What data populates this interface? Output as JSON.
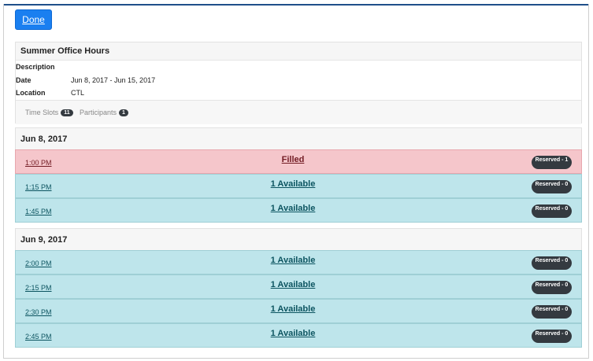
{
  "toolbar": {
    "done_label": "Done"
  },
  "event": {
    "title": "Summer Office Hours",
    "description_label": "Description",
    "date_label": "Date",
    "date_value": "Jun 8, 2017 - Jun 15, 2017",
    "location_label": "Location",
    "location_value": "CTL"
  },
  "tabs": [
    {
      "label": "Time Slots",
      "count": "11"
    },
    {
      "label": "Participants",
      "count": "1"
    }
  ],
  "days": [
    {
      "title": "Jun 8, 2017",
      "slots": [
        {
          "time": "1:00 PM",
          "status": "Filled",
          "reserved": "Reserved - 1",
          "state": "filled"
        },
        {
          "time": "1:15 PM",
          "status": "1 Available",
          "reserved": "Reserved - 0",
          "state": "available"
        },
        {
          "time": "1:45 PM",
          "status": "1 Available",
          "reserved": "Reserved - 0",
          "state": "available"
        }
      ]
    },
    {
      "title": "Jun 9, 2017",
      "slots": [
        {
          "time": "2:00 PM",
          "status": "1 Available",
          "reserved": "Reserved - 0",
          "state": "available"
        },
        {
          "time": "2:15 PM",
          "status": "1 Available",
          "reserved": "Reserved - 0",
          "state": "available"
        },
        {
          "time": "2:30 PM",
          "status": "1 Available",
          "reserved": "Reserved - 0",
          "state": "available"
        },
        {
          "time": "2:45 PM",
          "status": "1 Available",
          "reserved": "Reserved - 0",
          "state": "available"
        }
      ]
    }
  ],
  "colors": {
    "primary": "#1a7ff0",
    "available_bg": "#bee5eb",
    "filled_bg": "#f5c6cb",
    "badge_bg": "#343a40"
  }
}
